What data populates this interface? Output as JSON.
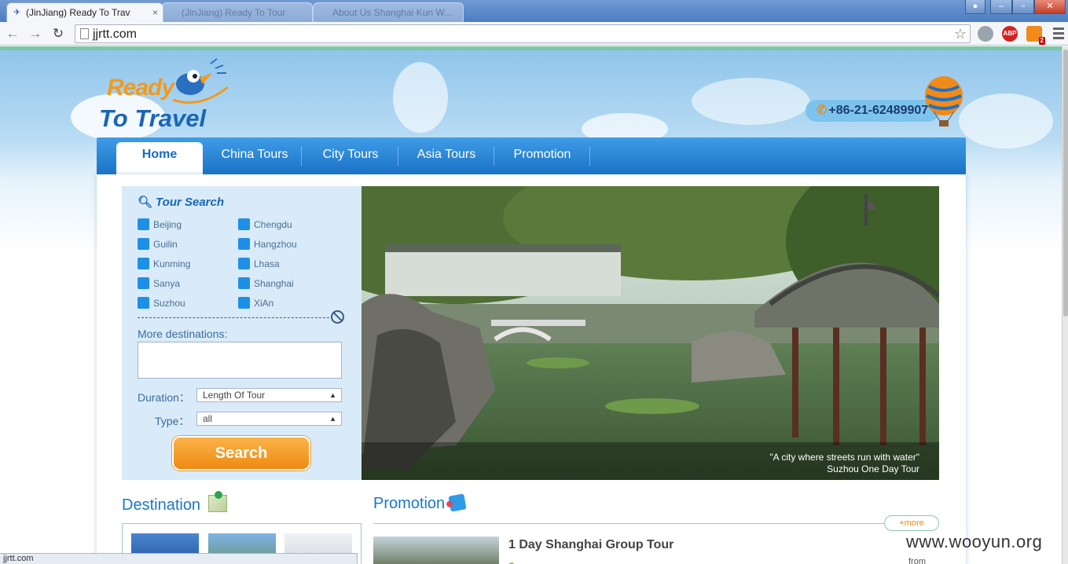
{
  "browser": {
    "active_tab_title": "(JinJiang) Ready To Trav",
    "tab_close": "×",
    "background_tabs": [
      "(JinJiang) Ready To Tour",
      "About Us Shanghai Kun W..."
    ],
    "url": "jjrtt.com",
    "status_text": "jjrtt.com",
    "extensions": {
      "abp": "ABP",
      "rss_badge": "2"
    },
    "window_controls": {
      "minimize": "–",
      "maximize": "▫",
      "close": "✕"
    }
  },
  "site": {
    "logo_ready": "Ready",
    "logo_to_travel": "To Travel",
    "phone": "+86-21-62489907",
    "nav": [
      "Home",
      "China Tours",
      "City Tours",
      "Asia Tours",
      "Promotion"
    ],
    "active_nav": "Home"
  },
  "search": {
    "title": "Tour Search",
    "cities": [
      "Beijing",
      "Chengdu",
      "Guilin",
      "Hangzhou",
      "Kunming",
      "Lhasa",
      "Sanya",
      "Shanghai",
      "Suzhou",
      "XiAn"
    ],
    "more_destinations_label": "More destinations:",
    "duration_label": "Duration：",
    "duration_value": "Length Of Tour",
    "type_label": "Type：",
    "type_value": "all",
    "button": "Search"
  },
  "hero": {
    "caption_quote": "\"A city where streets run with water\"",
    "caption_title": "Suzhou One Day Tour"
  },
  "destination": {
    "title": "Destination"
  },
  "promotion": {
    "title": "Promotion",
    "more": "+more",
    "first_item": "1 Day Shanghai Group Tour",
    "from_label": "from"
  },
  "watermark": "www.wooyun.org",
  "colors": {
    "brand_blue": "#1a72c6",
    "accent_orange": "#f39a1b",
    "panel_bg": "#d9ebf9"
  }
}
